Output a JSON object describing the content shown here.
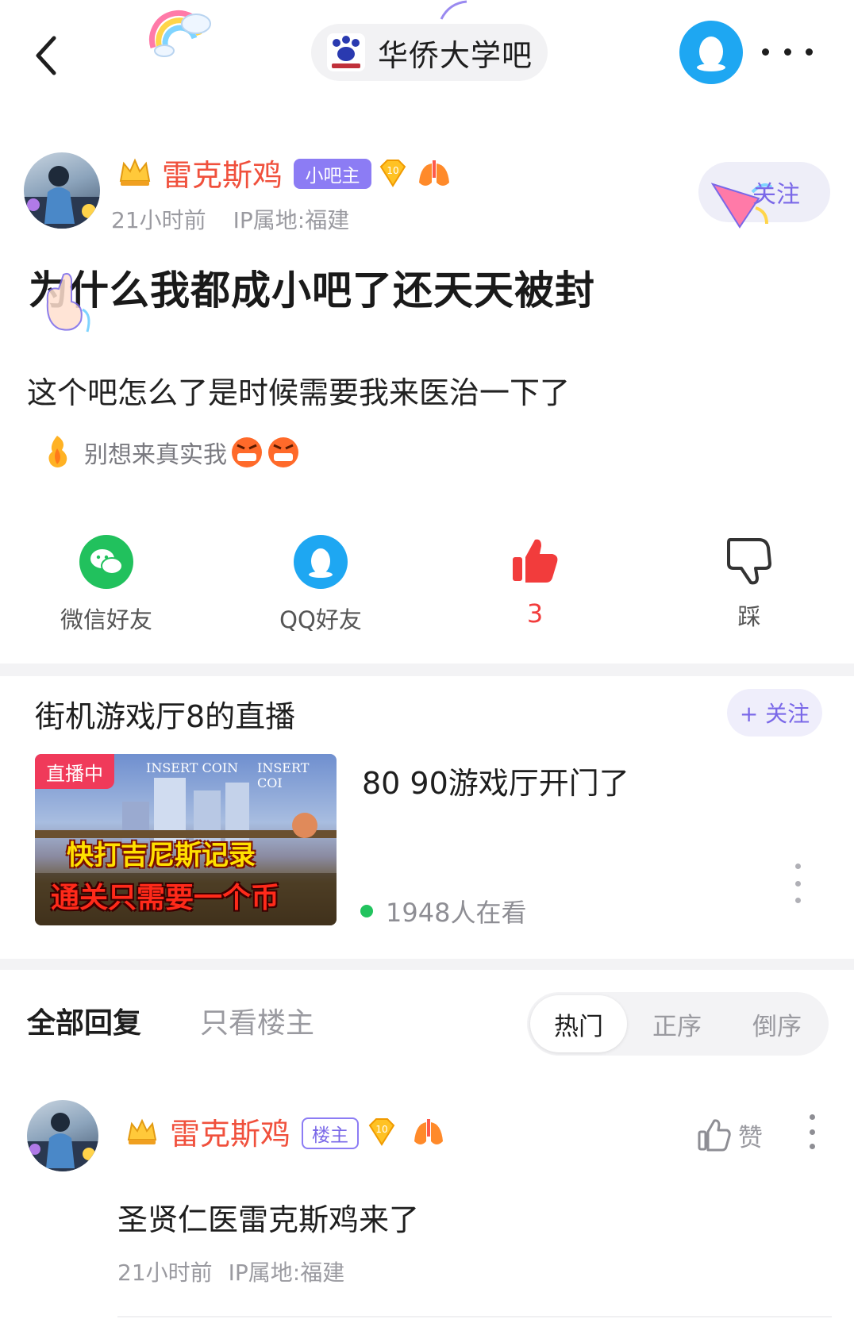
{
  "top_bar": {
    "forum_name": "华侨大学吧"
  },
  "post": {
    "author": {
      "name": "雷克斯鸡",
      "badge": "小吧主",
      "level": "10"
    },
    "time": "21小时前",
    "ip": "IP属地:福建",
    "follow_label": "关注",
    "title": "为什么我都成小吧了还天天被封",
    "body": "这个吧怎么了是时候需要我来医治一下了",
    "signature": "别想来真实我"
  },
  "share": {
    "wechat_label": "微信好友",
    "qq_label": "QQ好友",
    "like_count": "3",
    "dislike_label": "踩"
  },
  "live": {
    "section_title": "街机游戏厅8的直播",
    "follow_label": "+ 关注",
    "status_badge": "直播中",
    "thumb_line1": "快打吉尼斯记录",
    "thumb_line2": "通关只需要一个币",
    "thumb_insert1": "INSERT COIN",
    "thumb_insert2": "INSERT COI",
    "stream_title": "80 90游戏厅开门了",
    "viewers": "1948人在看"
  },
  "replies": {
    "tab_all": "全部回复",
    "tab_owner": "只看楼主",
    "sort": {
      "hot": "热门",
      "asc": "正序",
      "desc": "倒序",
      "active": "热门"
    },
    "items": [
      {
        "author": "雷克斯鸡",
        "badge": "楼主",
        "level": "10",
        "like_label": "赞",
        "text": "圣贤仁医雷克斯鸡来了",
        "time": "21小时前",
        "ip": "IP属地:福建"
      }
    ]
  },
  "colors": {
    "author_name": "#f0503c",
    "accent_purple": "#7a68e8",
    "wechat_green": "#21c15d",
    "qq_blue": "#1ea7f2",
    "like_red": "#f23c3c"
  }
}
